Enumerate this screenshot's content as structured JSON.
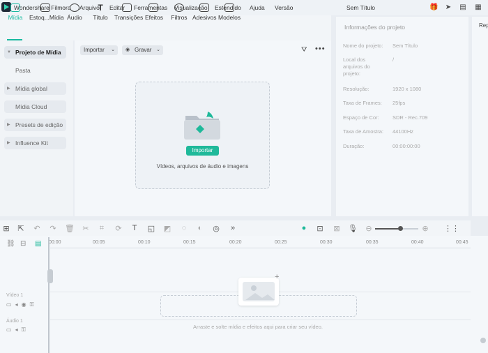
{
  "app": {
    "title": "Wondershare Filmora",
    "document_title": "Sem Título"
  },
  "menu": [
    "Arquivo",
    "Editar",
    "Ferramentas",
    "Visualização",
    "Estendido",
    "Ajuda",
    "Versão"
  ],
  "toolbar": {
    "tabs": [
      {
        "label": "Mídia",
        "active": true
      },
      {
        "label": "Estoq...Mídia"
      },
      {
        "label": "Áudio"
      },
      {
        "label": "Título"
      },
      {
        "label": "Transições"
      },
      {
        "label": "Efeitos"
      },
      {
        "label": "Filtros"
      },
      {
        "label": "Adesivos"
      },
      {
        "label": "Modelos"
      }
    ]
  },
  "sidebar": {
    "items": [
      {
        "label": "Projeto de Mídia"
      },
      {
        "label": "Pasta"
      },
      {
        "label": "Mídia global"
      },
      {
        "label": "Mídia Cloud"
      },
      {
        "label": "Presets de edição"
      },
      {
        "label": "Influence Kit"
      }
    ]
  },
  "media": {
    "import_dropdown": "Importar",
    "record_dropdown": "Gravar",
    "import_button": "Importar",
    "hint": "Vídeos, arquivos de áudio e imagens"
  },
  "project_info": {
    "title": "Informações do projeto",
    "rows": [
      {
        "key": "Nome do projeto:",
        "value": "Sem Título"
      },
      {
        "key": "Local dos arquivos do projeto:",
        "value": "/"
      },
      {
        "key": "Resolução:",
        "value": "1920 x 1080"
      },
      {
        "key": "Taxa de Frames:",
        "value": "25fps"
      },
      {
        "key": "Espaço de Cor:",
        "value": "SDR - Rec.709"
      },
      {
        "key": "Taxa de Amostra:",
        "value": "44100Hz"
      },
      {
        "key": "Duração:",
        "value": "00:00:00:00"
      }
    ]
  },
  "right_panel": {
    "label": "Rep"
  },
  "timeline": {
    "ticks": [
      "00:00",
      "00:05",
      "00:10",
      "00:15",
      "00:20",
      "00:25",
      "00:30",
      "00:35",
      "00:40",
      "00:45"
    ],
    "tracks": [
      {
        "label": "Vídeo 1"
      },
      {
        "label": "Áudio 1"
      }
    ],
    "drag_hint": "Arraste e solte mídia e efeitos aqui para criar seu vídeo.",
    "zoom_level": 0.58
  },
  "colors": {
    "accent": "#19b9a0",
    "import_button": "#1fb99a"
  }
}
